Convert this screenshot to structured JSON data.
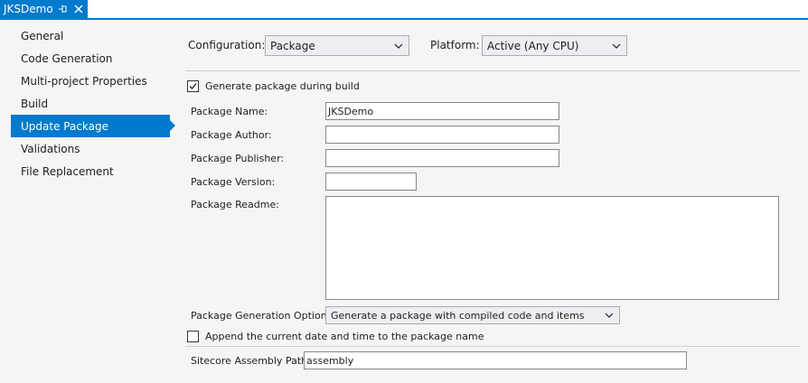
{
  "tab": {
    "title": "JKSDemo",
    "pin_icon": "pin-icon",
    "close_icon": "close-icon"
  },
  "nav": {
    "items": [
      {
        "label": "General"
      },
      {
        "label": "Code Generation"
      },
      {
        "label": "Multi-project Properties"
      },
      {
        "label": "Build"
      },
      {
        "label": "Update Package"
      },
      {
        "label": "Validations"
      },
      {
        "label": "File Replacement"
      }
    ],
    "selected": "Update Package"
  },
  "config": {
    "configuration_label": "Configuration:",
    "configuration_value": "Package",
    "platform_label": "Platform:",
    "platform_value": "Active (Any CPU)"
  },
  "form": {
    "generate_label": "Generate package during build",
    "generate_checked": true,
    "name_label": "Package Name:",
    "name_value": "JKSDemo",
    "author_label": "Package Author:",
    "author_value": "",
    "publisher_label": "Package Publisher:",
    "publisher_value": "",
    "version_label": "Package Version:",
    "version_value": "",
    "readme_label": "Package Readme:",
    "readme_value": "",
    "options_label": "Package Generation Options:",
    "options_value": "Generate a package with compiled code and items",
    "append_label": "Append the current date and time to the package name",
    "append_checked": false,
    "assembly_label": "Sitecore Assembly Path:",
    "assembly_value": "assembly"
  },
  "colors": {
    "accent": "#007acc",
    "panel_background": "#f5f5f5",
    "combo_background": "#eeeef2"
  }
}
